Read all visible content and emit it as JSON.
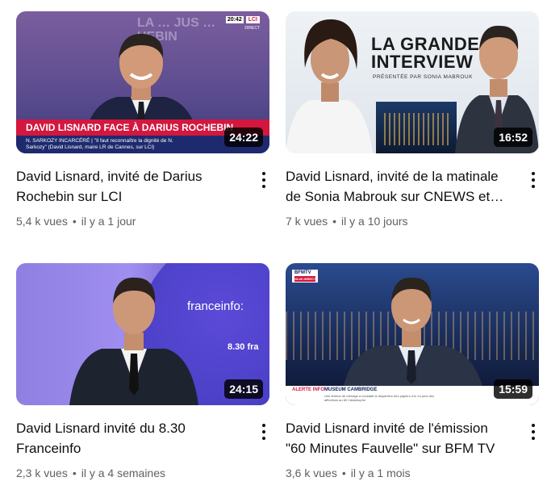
{
  "videos": [
    {
      "title": "David Lisnard, invité de Darius Rochebin sur LCI",
      "duration": "24:22",
      "views": "5,4 k vues",
      "age": "il y a 1 jour",
      "thumb_texts": {
        "banner": "DAVID LISNARD FACE À DARIUS ROCHEBIN",
        "subline1": "N. SARKOZY INCARCÉRÉ | \"Il faut reconnaître la dignité de N.",
        "subline2": "Sarkozy\" (David Lisnard, maire LR de Cannes, sur LCI)",
        "clock": "20:42",
        "channel": "LCI",
        "live": "DIRECT",
        "bg_text": "LA … JUS … HEBIN"
      }
    },
    {
      "title": "David Lisnard, invité de la matinale de Sonia Mabrouk sur CNEWS et…",
      "duration": "16:52",
      "views": "7 k vues",
      "age": "il y a 10 jours",
      "thumb_texts": {
        "line1": "LA GRANDE",
        "line2": "INTERVIEW",
        "line3": "PRÉSENTÉE PAR SONIA MABROUK"
      }
    },
    {
      "title": "David Lisnard invité du 8.30 Franceinfo",
      "duration": "24:15",
      "views": "2,3 k vues",
      "age": "il y a 4 semaines",
      "thumb_texts": {
        "channel": "franceinfo:",
        "show": "8.30 fra"
      }
    },
    {
      "title": "David Lisnard invité de l'émission \"60 Minutes Fauvelle\" sur BFM TV",
      "duration": "15:59",
      "views": "3,6 k vues",
      "age": "il y a 1 mois",
      "thumb_texts": {
        "channel": "BFMTV",
        "channel_sub": "18:26 DIRECT",
        "alert_label": "ALERTE INFO",
        "alert_title": "MUSEUM CAMBRIDGE",
        "alert_text": "Une femme de ménage a constaté la disparition des papiers d'or en plus des affections au 60 Catastrophe"
      }
    }
  ],
  "colors": {
    "title": "#0f0f0f",
    "meta": "#606060",
    "duration_bg": "#000000cc",
    "lci_red": "#d3173e",
    "lci_blue": "#1e2a6e"
  },
  "icons": {
    "more": "more-vert-icon"
  }
}
